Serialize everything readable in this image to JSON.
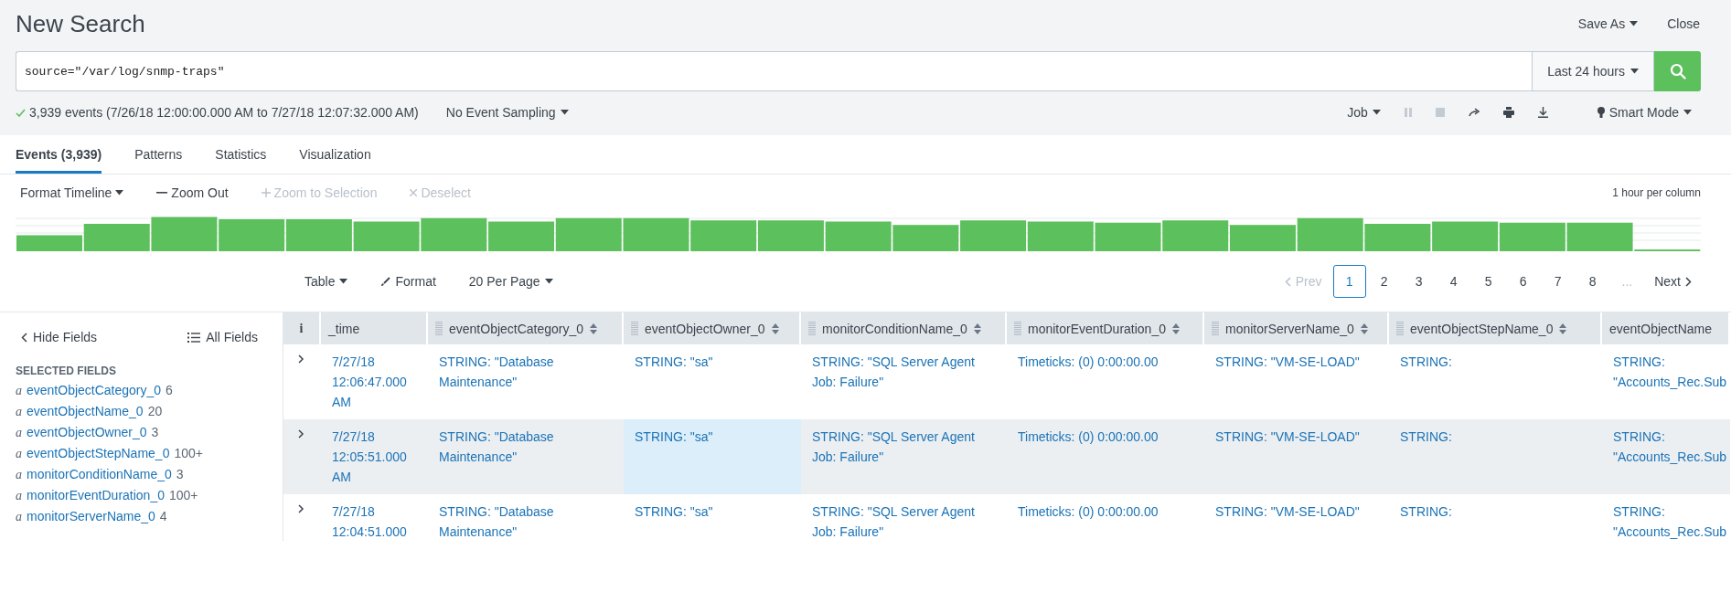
{
  "title": "New Search",
  "header_actions": [
    {
      "label": "Save As",
      "dropdown": true
    },
    {
      "label": "Close",
      "dropdown": false
    }
  ],
  "search": {
    "query": "source=\"/var/log/snmp-traps\"",
    "time_range": "Last 24 hours"
  },
  "status": {
    "summary": "3,939 events (7/26/18 12:00:00.000 AM to 7/27/18 12:07:32.000 AM)",
    "sampling": "No Event Sampling"
  },
  "job_controls": {
    "job": "Job",
    "mode": "Smart Mode"
  },
  "tabs": [
    {
      "label": "Events (3,939)",
      "selected": true
    },
    {
      "label": "Patterns",
      "selected": false
    },
    {
      "label": "Statistics",
      "selected": false
    },
    {
      "label": "Visualization",
      "selected": false
    }
  ],
  "timeline": {
    "actions": [
      {
        "label": "Format Timeline",
        "kind": "dropdown",
        "disabled": false
      },
      {
        "label": "Zoom Out",
        "kind": "minus",
        "disabled": false
      },
      {
        "label": "Zoom to Selection",
        "kind": "plus",
        "disabled": true
      },
      {
        "label": "Deselect",
        "kind": "cross",
        "disabled": true
      }
    ],
    "scale": "1 hour per column"
  },
  "results_toolbar": {
    "view": "Table",
    "format": "Format",
    "per_page": "20 Per Page"
  },
  "pagination": {
    "prev": "Prev",
    "prev_disabled": true,
    "pages": [
      {
        "label": "1",
        "selected": true
      },
      {
        "label": "2",
        "selected": false
      },
      {
        "label": "3",
        "selected": false
      },
      {
        "label": "4",
        "selected": false
      },
      {
        "label": "5",
        "selected": false
      },
      {
        "label": "6",
        "selected": false
      },
      {
        "label": "7",
        "selected": false
      },
      {
        "label": "8",
        "selected": false
      }
    ],
    "ellipsis": "...",
    "next": "Next"
  },
  "fields": {
    "hide": "Hide Fields",
    "all": "All Fields",
    "section": "SELECTED FIELDS",
    "items": [
      {
        "type": "a",
        "name": "eventObjectCategory_0",
        "count": "6"
      },
      {
        "type": "a",
        "name": "eventObjectName_0",
        "count": "20"
      },
      {
        "type": "a",
        "name": "eventObjectOwner_0",
        "count": "3"
      },
      {
        "type": "a",
        "name": "eventObjectStepName_0",
        "count": "100+"
      },
      {
        "type": "a",
        "name": "monitorConditionName_0",
        "count": "3"
      },
      {
        "type": "a",
        "name": "monitorEventDuration_0",
        "count": "100+"
      },
      {
        "type": "a",
        "name": "monitorServerName_0",
        "count": "4"
      }
    ]
  },
  "table": {
    "info_header": "i",
    "columns": [
      {
        "label": "_time",
        "sortable": false
      },
      {
        "label": "eventObjectCategory_0",
        "sortable": true
      },
      {
        "label": "eventObjectOwner_0",
        "sortable": true
      },
      {
        "label": "monitorConditionName_0",
        "sortable": true
      },
      {
        "label": "monitorEventDuration_0",
        "sortable": true
      },
      {
        "label": "monitorServerName_0",
        "sortable": true
      },
      {
        "label": "eventObjectStepName_0",
        "sortable": true
      },
      {
        "label": "eventObjectName",
        "sortable": false
      }
    ],
    "rows": [
      {
        "expanded": false,
        "highlighted": false,
        "cells": [
          {
            "text": "7/27/18 12:06:47.000 AM",
            "hovered": false
          },
          {
            "text": "STRING: \"Database Maintenance\"",
            "hovered": false
          },
          {
            "text": "STRING: \"sa\"",
            "hovered": false
          },
          {
            "text": "STRING: \"SQL Server Agent Job: Failure\"",
            "hovered": false
          },
          {
            "text": "Timeticks: (0) 0:00:00.00",
            "hovered": false
          },
          {
            "text": "STRING: \"VM-SE-LOAD\"",
            "hovered": false
          },
          {
            "text": "STRING:",
            "hovered": false
          },
          {
            "text": "STRING: \"Accounts_Rec.Sub",
            "hovered": false
          }
        ]
      },
      {
        "expanded": false,
        "highlighted": true,
        "cells": [
          {
            "text": "7/27/18 12:05:51.000 AM",
            "hovered": false
          },
          {
            "text": "STRING: \"Database Maintenance\"",
            "hovered": false
          },
          {
            "text": "STRING: \"sa\"",
            "hovered": true
          },
          {
            "text": "STRING: \"SQL Server Agent Job: Failure\"",
            "hovered": false
          },
          {
            "text": "Timeticks: (0) 0:00:00.00",
            "hovered": false
          },
          {
            "text": "STRING: \"VM-SE-LOAD\"",
            "hovered": false
          },
          {
            "text": "STRING:",
            "hovered": false
          },
          {
            "text": "STRING: \"Accounts_Rec.Sub",
            "hovered": false
          }
        ]
      },
      {
        "expanded": false,
        "highlighted": false,
        "cells": [
          {
            "text": "7/27/18 12:04:51.000",
            "hovered": false
          },
          {
            "text": "STRING: \"Database Maintenance\"",
            "hovered": false
          },
          {
            "text": "STRING: \"sa\"",
            "hovered": false
          },
          {
            "text": "STRING: \"SQL Server Agent Job: Failure\"",
            "hovered": false
          },
          {
            "text": "Timeticks: (0) 0:00:00.00",
            "hovered": false
          },
          {
            "text": "STRING: \"VM-SE-LOAD\"",
            "hovered": false
          },
          {
            "text": "STRING:",
            "hovered": false
          },
          {
            "text": "STRING: \"Accounts_Rec.Sub",
            "hovered": false
          }
        ]
      }
    ]
  }
}
